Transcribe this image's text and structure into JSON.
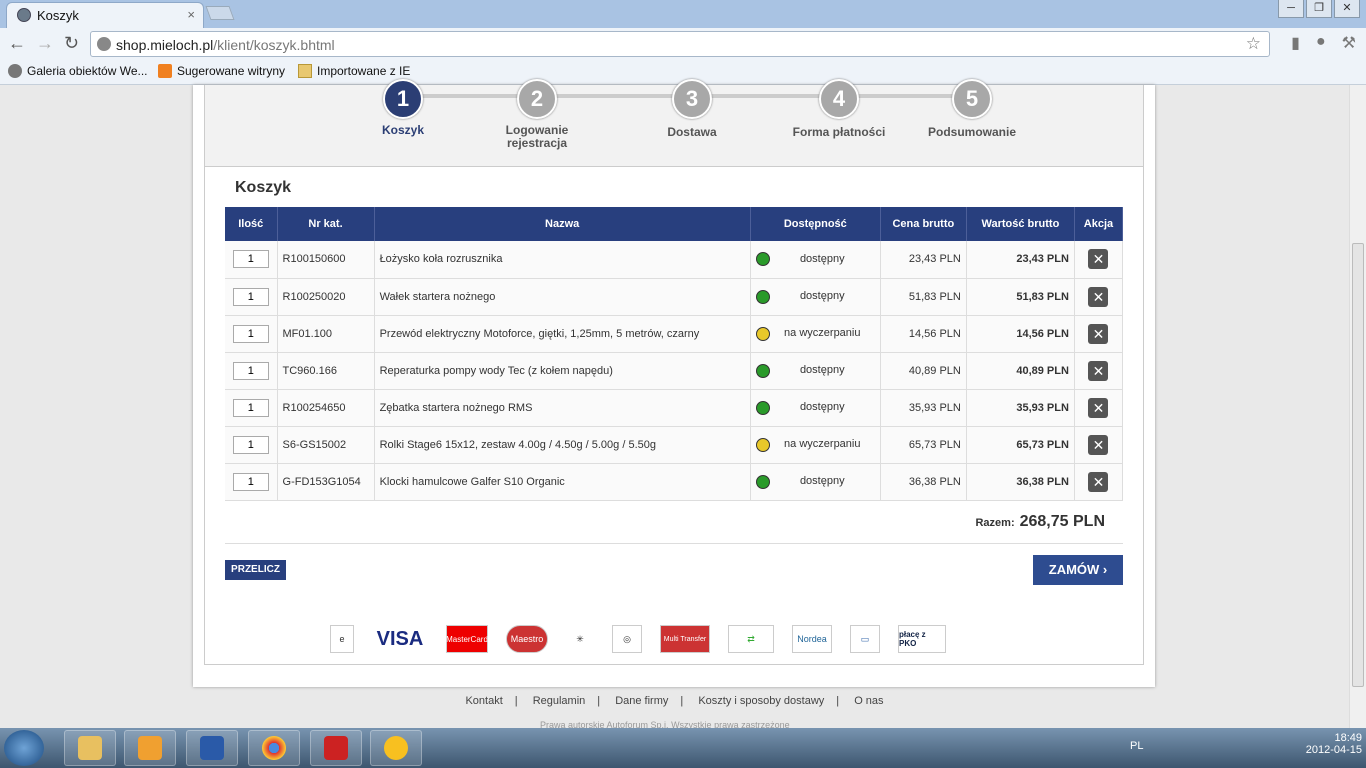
{
  "browser": {
    "tab_title": "Koszyk",
    "tab_close": "×",
    "url_host": "shop.mieloch.pl",
    "url_path": "/klient/koszyk.bhtml",
    "win_min": "─",
    "win_max": "❐",
    "win_close": "✕",
    "bookmarks": [
      "Galeria obiektów We...",
      "Sugerowane witryny",
      "Importowane z IE"
    ]
  },
  "steps": [
    {
      "num": "1",
      "label": "Koszyk"
    },
    {
      "num": "2",
      "label": "Logowanie rejestracja"
    },
    {
      "num": "3",
      "label": "Dostawa"
    },
    {
      "num": "4",
      "label": "Forma płatności"
    },
    {
      "num": "5",
      "label": "Podsumowanie"
    }
  ],
  "cart": {
    "heading": "Koszyk",
    "headers": [
      "Ilość",
      "Nr kat.",
      "Nazwa",
      "Dostępność",
      "Cena brutto",
      "Wartość brutto",
      "Akcja"
    ],
    "rows": [
      {
        "qty": "1",
        "code": "R100150600",
        "name": "Łożysko koła rozrusznika",
        "status": "dostępny",
        "mood": "green",
        "price": "23,43 PLN",
        "total": "23,43 PLN"
      },
      {
        "qty": "1",
        "code": "R100250020",
        "name": "Wałek startera nożnego",
        "status": "dostępny",
        "mood": "green",
        "price": "51,83 PLN",
        "total": "51,83 PLN"
      },
      {
        "qty": "1",
        "code": "MF01.100",
        "name": "Przewód elektryczny Motoforce, giętki, 1,25mm, 5 metrów, czarny",
        "status": "na wyczerpaniu",
        "mood": "yellow",
        "price": "14,56 PLN",
        "total": "14,56 PLN"
      },
      {
        "qty": "1",
        "code": "TC960.166",
        "name": "Reperaturka pompy wody Tec (z kołem napędu)",
        "status": "dostępny",
        "mood": "green",
        "price": "40,89 PLN",
        "total": "40,89 PLN"
      },
      {
        "qty": "1",
        "code": "R100254650",
        "name": "Zębatka startera nożnego RMS",
        "status": "dostępny",
        "mood": "green",
        "price": "35,93 PLN",
        "total": "35,93 PLN"
      },
      {
        "qty": "1",
        "code": "S6-GS15002",
        "name": "Rolki Stage6 15x12, zestaw 4.00g / 4.50g / 5.00g / 5.50g",
        "status": "na wyczerpaniu",
        "mood": "yellow",
        "price": "65,73 PLN",
        "total": "65,73 PLN"
      },
      {
        "qty": "1",
        "code": "G-FD153G1054",
        "name": "Klocki hamulcowe Galfer S10 Organic",
        "status": "dostępny",
        "mood": "green",
        "price": "36,38 PLN",
        "total": "36,38 PLN"
      }
    ],
    "total_label": "Razem:",
    "total_value": "268,75 PLN",
    "recalc": "PRZELICZ",
    "order": "ZAMÓW ›"
  },
  "payments": [
    "VISA",
    "MasterCard",
    "Maestro",
    "Multi Transfer",
    "Nordea",
    "płacę z PKO"
  ],
  "footer": {
    "links": [
      "Kontakt",
      "Regulamin",
      "Dane firmy",
      "Koszty i sposoby dostawy",
      "O nas"
    ],
    "copyright": "Prawa autorskie Autoforum Sp.j. Wszystkie prawa zastrzeżone"
  },
  "taskbar": {
    "lang": "PL",
    "time": "18:49",
    "date": "2012-04-15"
  },
  "colors": {
    "navy": "#283f7e",
    "green": "#2a9a2a",
    "yellow": "#e8c82a"
  }
}
